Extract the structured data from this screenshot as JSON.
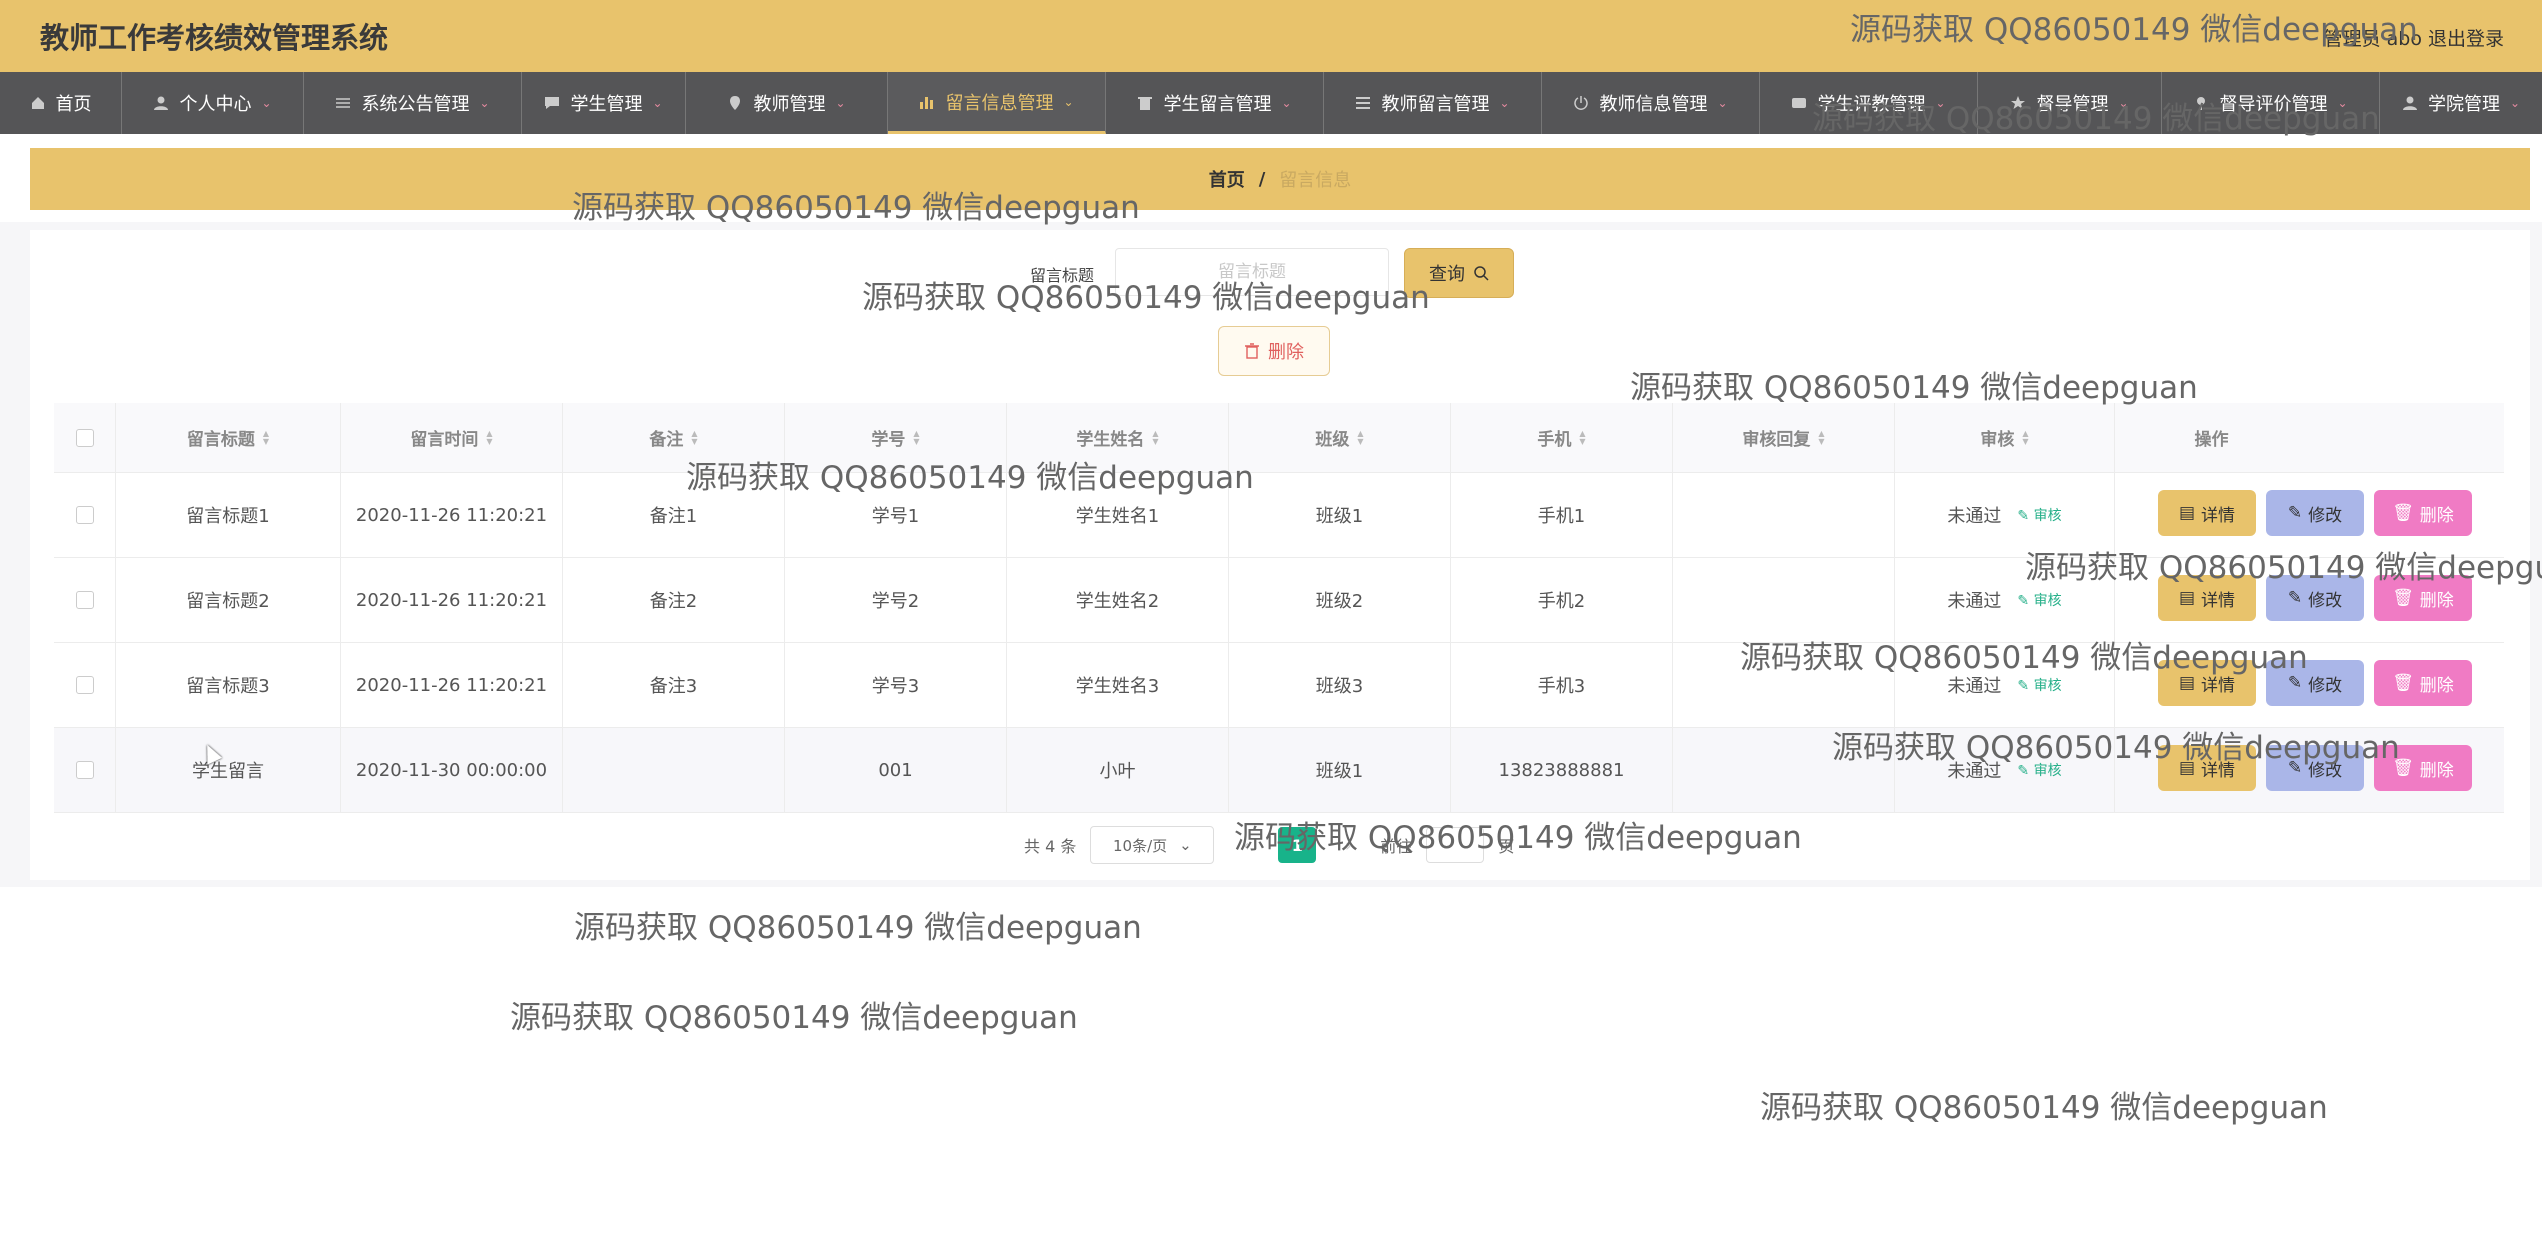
{
  "header": {
    "app_title": "教师工作考核绩效管理系统",
    "user_label": "管理员 abo",
    "logout_label": "退出登录"
  },
  "nav": {
    "items": [
      {
        "label": "首页",
        "icon": "home-icon",
        "active": false
      },
      {
        "label": "个人中心",
        "icon": "user-icon",
        "active": false
      },
      {
        "label": "系统公告管理",
        "icon": "sliders-icon",
        "active": false
      },
      {
        "label": "学生管理",
        "icon": "chat-icon",
        "active": false
      },
      {
        "label": "教师管理",
        "icon": "location-icon",
        "active": false
      },
      {
        "label": "留言信息管理",
        "icon": "bar-chart-icon",
        "active": true
      },
      {
        "label": "学生留言管理",
        "icon": "trash-icon",
        "active": false
      },
      {
        "label": "教师留言管理",
        "icon": "menu-icon",
        "active": false
      },
      {
        "label": "教师信息管理",
        "icon": "power-icon",
        "active": false
      },
      {
        "label": "学生评教管理",
        "icon": "tag-icon",
        "active": false
      },
      {
        "label": "督导管理",
        "icon": "star-icon",
        "active": false
      },
      {
        "label": "督导评价管理",
        "icon": "pin-icon",
        "active": false
      },
      {
        "label": "学院管理",
        "icon": "user-icon",
        "active": false
      }
    ]
  },
  "breadcrumb": {
    "home": "首页",
    "sep": "/",
    "current": "留言信息"
  },
  "search": {
    "label": "留言标题",
    "placeholder": "留言标题",
    "query_label": "查询"
  },
  "bulk_delete_label": "删除",
  "table": {
    "columns": [
      "留言标题",
      "留言时间",
      "备注",
      "学号",
      "学生姓名",
      "班级",
      "手机",
      "审核回复",
      "审核",
      "操作"
    ],
    "rows": [
      {
        "title": "留言标题1",
        "time": "2020-11-26 11:20:21",
        "remark": "备注1",
        "student_no": "学号1",
        "student_name": "学生姓名1",
        "class": "班级1",
        "phone": "手机1",
        "reply": "",
        "status": "未通过",
        "audit": "审核"
      },
      {
        "title": "留言标题2",
        "time": "2020-11-26 11:20:21",
        "remark": "备注2",
        "student_no": "学号2",
        "student_name": "学生姓名2",
        "class": "班级2",
        "phone": "手机2",
        "reply": "",
        "status": "未通过",
        "audit": "审核"
      },
      {
        "title": "留言标题3",
        "time": "2020-11-26 11:20:21",
        "remark": "备注3",
        "student_no": "学号3",
        "student_name": "学生姓名3",
        "class": "班级3",
        "phone": "手机3",
        "reply": "",
        "status": "未通过",
        "audit": "审核"
      },
      {
        "title": "学生留言",
        "time": "2020-11-30 00:00:00",
        "remark": "",
        "student_no": "001",
        "student_name": "小叶",
        "class": "班级1",
        "phone": "13823888881",
        "reply": "",
        "status": "未通过",
        "audit": "审核"
      }
    ],
    "actions": {
      "detail": "详情",
      "edit": "修改",
      "delete": "删除"
    }
  },
  "pagination": {
    "total": "共 4 条",
    "page_size": "10条/页",
    "current_page": "1",
    "goto_prefix": "前往",
    "goto_suffix": "页"
  },
  "watermark": "源码获取 QQ86050149 微信deepguan",
  "colors": {
    "primary": "#e8c36c",
    "nav_bg": "#555557",
    "detail": "#e8c36c",
    "edit": "#aab6e8",
    "delete": "#f07bc4",
    "page_active": "#18b38a"
  }
}
